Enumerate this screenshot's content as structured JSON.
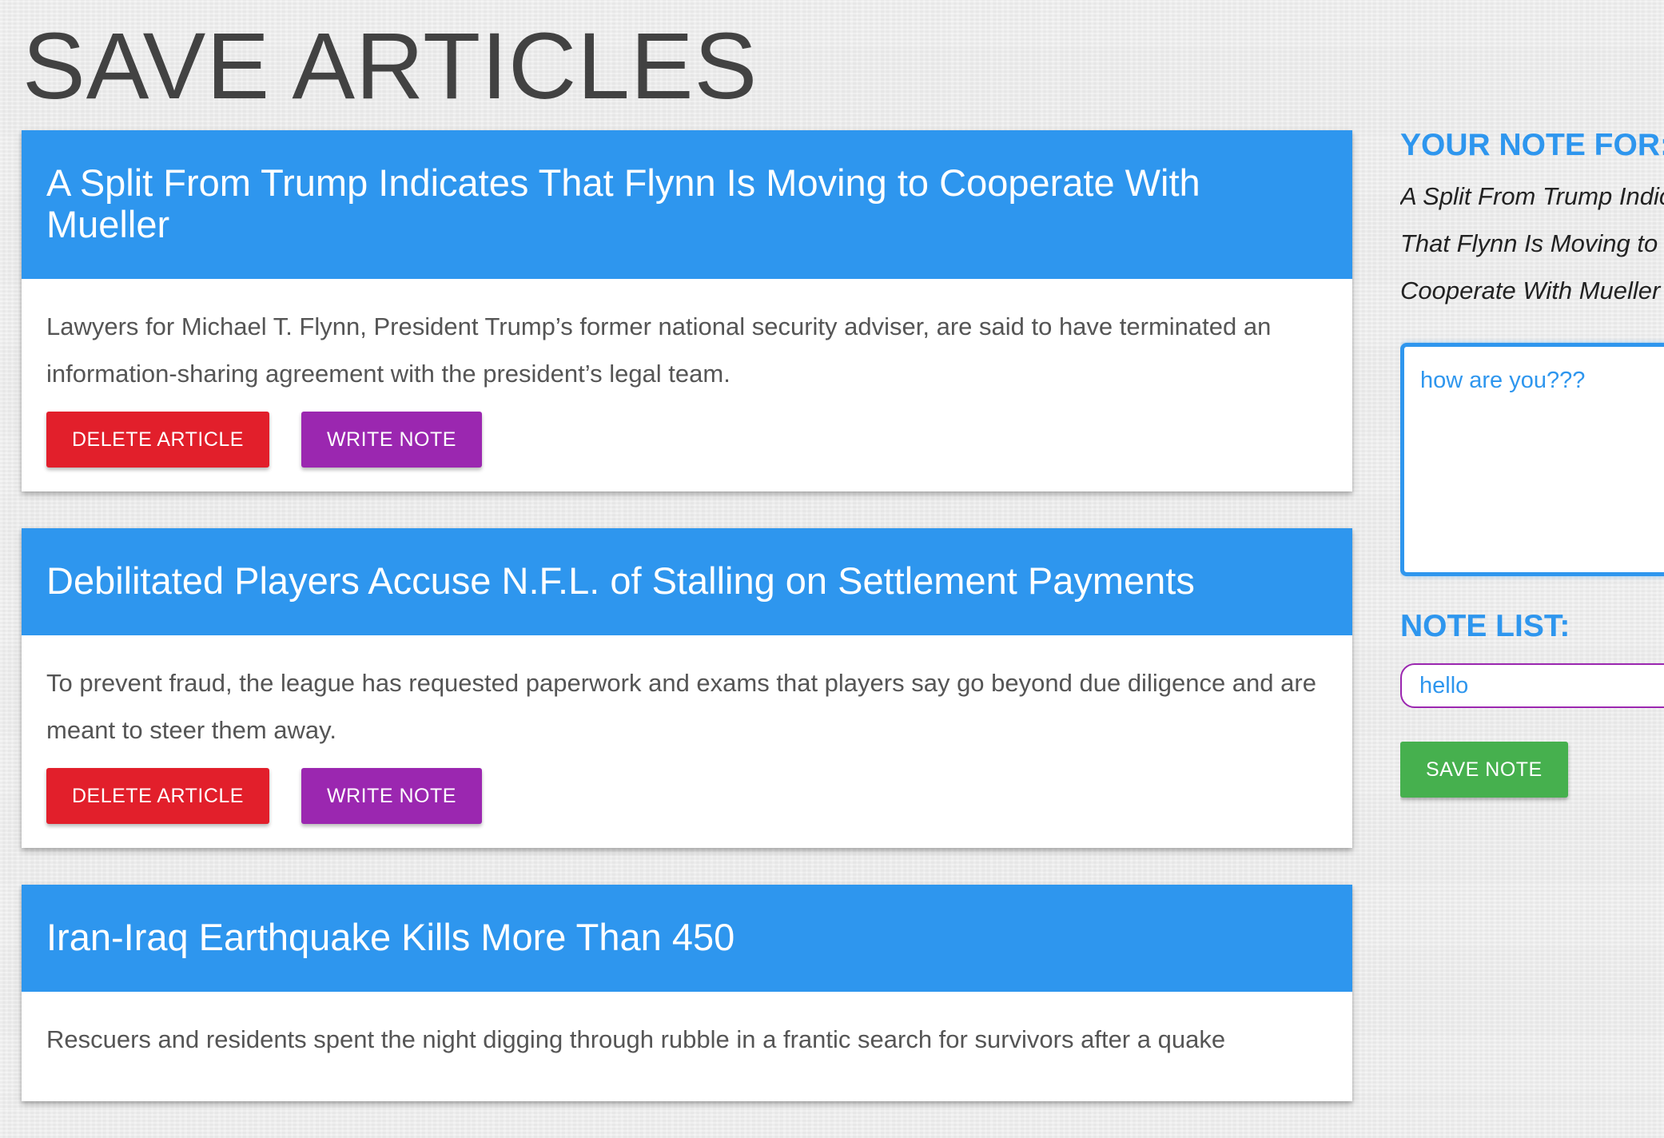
{
  "page": {
    "title": "SAVE ARTICLES"
  },
  "articles": [
    {
      "title": "A Split From Trump Indicates That Flynn Is Moving to Cooperate With Mueller",
      "summary": "Lawyers for Michael T. Flynn, President Trump’s former national security adviser, are said to have terminated an information-sharing agreement with the president’s legal team.",
      "delete_label": "DELETE ARTICLE",
      "note_label": "WRITE NOTE"
    },
    {
      "title": "Debilitated Players Accuse N.F.L. of Stalling on Settlement Payments",
      "summary": "To prevent fraud, the league has requested paperwork and exams that players say go beyond due diligence and are meant to steer them away.",
      "delete_label": "DELETE ARTICLE",
      "note_label": "WRITE NOTE"
    },
    {
      "title": "Iran-Iraq Earthquake Kills More Than 450",
      "summary": "Rescuers and residents spent the night digging through rubble in a frantic search for survivors after a quake"
    }
  ],
  "sidebar": {
    "note_for_heading": "YOUR NOTE FOR:",
    "note_for_title": "A Split From Trump Indicates That Flynn Is Moving to Cooperate With Mueller",
    "note_text": "how are you???",
    "note_list_heading": "NOTE LIST:",
    "notes": [
      "hello"
    ],
    "save_label": "SAVE NOTE"
  },
  "colors": {
    "accent_blue": "#2e96ee",
    "delete_red": "#e21f2b",
    "note_purple": "#9b27b0",
    "save_green": "#46b04e"
  }
}
